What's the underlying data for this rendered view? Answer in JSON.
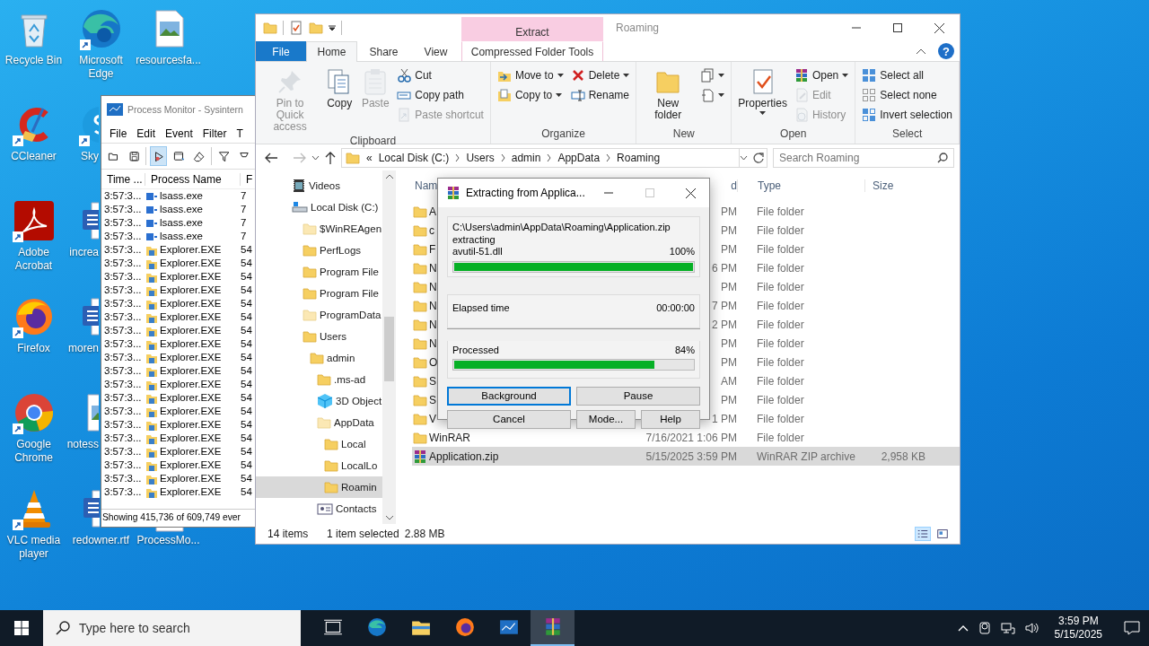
{
  "desktop": {
    "columns": [
      [
        {
          "label": "Recycle Bin",
          "kind": "recycle",
          "shortcut": false
        },
        {
          "label": "CCleaner",
          "kind": "ccleaner",
          "shortcut": true
        },
        {
          "label": "Adobe Acrobat",
          "kind": "acrobat",
          "shortcut": true
        },
        {
          "label": "Firefox",
          "kind": "firefox",
          "shortcut": true
        },
        {
          "label": "Google Chrome",
          "kind": "chrome",
          "shortcut": true
        },
        {
          "label": "VLC media player",
          "kind": "vlc",
          "shortcut": true
        }
      ],
      [
        {
          "label": "Microsoft Edge",
          "kind": "edge",
          "shortcut": true
        },
        {
          "label": "Sky",
          "kind": "skype",
          "shortcut": true
        },
        {
          "label": "increa",
          "kind": "word",
          "shortcut": false
        },
        {
          "label": "moren",
          "kind": "word",
          "shortcut": false
        },
        {
          "label": "notess",
          "kind": "image",
          "shortcut": false
        },
        {
          "label": "redowner.rtf",
          "kind": "word",
          "shortcut": false
        }
      ],
      [
        {
          "label": "resourcesfa...",
          "kind": "image",
          "shortcut": false
        },
        {
          "label": "ProcessMo...",
          "kind": "file",
          "shortcut": false
        }
      ]
    ]
  },
  "process_monitor": {
    "title": "Process Monitor - Sysintern",
    "menu": [
      "File",
      "Edit",
      "Event",
      "Filter",
      "T"
    ],
    "toolbar": [
      {
        "kind": "open",
        "on": false
      },
      {
        "kind": "save",
        "on": false
      },
      {
        "kind": "capture",
        "on": true
      },
      {
        "kind": "autoscroll",
        "on": false
      },
      {
        "kind": "clear",
        "on": false
      },
      {
        "kind": "filter",
        "on": false
      },
      {
        "kind": "highlight",
        "on": false
      }
    ],
    "columns": [
      "Time ...",
      "Process Name",
      "F"
    ],
    "rows": [
      {
        "time": "3:57:3...",
        "process": "lsass.exe",
        "kind": "service",
        "column_3": "7"
      },
      {
        "time": "3:57:3...",
        "process": "lsass.exe",
        "kind": "service",
        "column_3": "7"
      },
      {
        "time": "3:57:3...",
        "process": "lsass.exe",
        "kind": "service",
        "column_3": "7"
      },
      {
        "time": "3:57:3...",
        "process": "lsass.exe",
        "kind": "service",
        "column_3": "7"
      },
      {
        "time": "3:57:3...",
        "process": "Explorer.EXE",
        "kind": "explorer",
        "column_3": "54"
      },
      {
        "time": "3:57:3...",
        "process": "Explorer.EXE",
        "kind": "explorer",
        "column_3": "54"
      },
      {
        "time": "3:57:3...",
        "process": "Explorer.EXE",
        "kind": "explorer",
        "column_3": "54"
      },
      {
        "time": "3:57:3...",
        "process": "Explorer.EXE",
        "kind": "explorer",
        "column_3": "54"
      },
      {
        "time": "3:57:3...",
        "process": "Explorer.EXE",
        "kind": "explorer",
        "column_3": "54"
      },
      {
        "time": "3:57:3...",
        "process": "Explorer.EXE",
        "kind": "explorer",
        "column_3": "54"
      },
      {
        "time": "3:57:3...",
        "process": "Explorer.EXE",
        "kind": "explorer",
        "column_3": "54"
      },
      {
        "time": "3:57:3...",
        "process": "Explorer.EXE",
        "kind": "explorer",
        "column_3": "54"
      },
      {
        "time": "3:57:3...",
        "process": "Explorer.EXE",
        "kind": "explorer",
        "column_3": "54"
      },
      {
        "time": "3:57:3...",
        "process": "Explorer.EXE",
        "kind": "explorer",
        "column_3": "54"
      },
      {
        "time": "3:57:3...",
        "process": "Explorer.EXE",
        "kind": "explorer",
        "column_3": "54"
      },
      {
        "time": "3:57:3...",
        "process": "Explorer.EXE",
        "kind": "explorer",
        "column_3": "54"
      },
      {
        "time": "3:57:3...",
        "process": "Explorer.EXE",
        "kind": "explorer",
        "column_3": "54"
      },
      {
        "time": "3:57:3...",
        "process": "Explorer.EXE",
        "kind": "explorer",
        "column_3": "54"
      },
      {
        "time": "3:57:3...",
        "process": "Explorer.EXE",
        "kind": "explorer",
        "column_3": "54"
      },
      {
        "time": "3:57:3...",
        "process": "Explorer.EXE",
        "kind": "explorer",
        "column_3": "54"
      },
      {
        "time": "3:57:3...",
        "process": "Explorer.EXE",
        "kind": "explorer",
        "column_3": "54"
      },
      {
        "time": "3:57:3...",
        "process": "Explorer.EXE",
        "kind": "explorer",
        "column_3": "54"
      },
      {
        "time": "3:57:3...",
        "process": "Explorer.EXE",
        "kind": "explorer",
        "column_3": "54"
      }
    ],
    "status": "Showing 415,736 of 609,749 ever"
  },
  "explorer": {
    "title": "Roaming",
    "context_group": "Extract",
    "tabs": [
      {
        "label": "File",
        "kind": "file",
        "selected": false
      },
      {
        "label": "Home",
        "kind": "tab",
        "selected": true
      },
      {
        "label": "Share",
        "kind": "tab",
        "selected": false
      },
      {
        "label": "View",
        "kind": "tab",
        "selected": false
      },
      {
        "label": "Compressed Folder Tools",
        "kind": "context",
        "selected": false
      }
    ],
    "help": "?",
    "ribbon": [
      {
        "label": "Clipboard",
        "large": [
          {
            "label": "Pin to Quick access",
            "kind": "pin",
            "disabled": true,
            "dropdown": false
          },
          {
            "label": "Copy",
            "kind": "copy",
            "disabled": false,
            "dropdown": false
          },
          {
            "label": "Paste",
            "kind": "paste",
            "disabled": true,
            "dropdown": false
          }
        ],
        "small": [
          {
            "label": "Cut",
            "kind": "cut",
            "disabled": false,
            "dropdown": false
          },
          {
            "label": "Copy path",
            "kind": "copy-path",
            "disabled": false,
            "dropdown": false
          },
          {
            "label": "Paste shortcut",
            "kind": "paste-shortcut",
            "disabled": true,
            "dropdown": false
          }
        ]
      },
      {
        "label": "Organize",
        "small": [
          {
            "label": "Move to",
            "kind": "move",
            "disabled": false,
            "dropdown": true
          },
          {
            "label": "Copy to",
            "kind": "copy-to",
            "disabled": false,
            "dropdown": true
          },
          {
            "label": "Delete",
            "kind": "delete",
            "disabled": false,
            "dropdown": true
          },
          {
            "label": "Rename",
            "kind": "rename",
            "disabled": false,
            "dropdown": false
          }
        ]
      },
      {
        "label": "New",
        "large": [
          {
            "label": "New folder",
            "kind": "new-folder",
            "disabled": false,
            "dropdown": false
          }
        ],
        "small": [
          {
            "kind": "new-item",
            "disabled": false,
            "dropdown": true
          },
          {
            "kind": "easy-access",
            "disabled": false,
            "dropdown": true
          }
        ]
      },
      {
        "label": "Open",
        "large": [
          {
            "label": "Properties",
            "kind": "properties",
            "disabled": false,
            "dropdown": true
          }
        ],
        "small": [
          {
            "label": "Open",
            "kind": "open",
            "disabled": false,
            "dropdown": true
          },
          {
            "label": "Edit",
            "kind": "edit",
            "disabled": true,
            "dropdown": false
          },
          {
            "label": "History",
            "kind": "history",
            "disabled": true,
            "dropdown": false
          }
        ]
      },
      {
        "label": "Select",
        "small": [
          {
            "label": "Select all",
            "kind": "select-all",
            "disabled": false,
            "dropdown": false
          },
          {
            "label": "Select none",
            "kind": "select-none",
            "disabled": false,
            "dropdown": false
          },
          {
            "label": "Invert selection",
            "kind": "invert",
            "disabled": false,
            "dropdown": false
          }
        ]
      }
    ],
    "address": {
      "overflow": "«",
      "crumbs": [
        "Local Disk (C:)",
        "Users",
        "admin",
        "AppData",
        "Roaming"
      ],
      "search_placeholder": "Search Roaming"
    },
    "navigation": [
      {
        "label": "Videos",
        "kind": "video",
        "selected": false
      },
      {
        "label": "Local Disk (C:)",
        "kind": "drive",
        "selected": false,
        "children": [
          {
            "label": "$WinREAgen",
            "kind": "hidden-folder",
            "selected": false
          },
          {
            "label": "PerfLogs",
            "kind": "folder",
            "selected": false
          },
          {
            "label": "Program File",
            "kind": "folder",
            "selected": false
          },
          {
            "label": "Program File",
            "kind": "folder",
            "selected": false
          },
          {
            "label": "ProgramData",
            "kind": "hidden-folder",
            "selected": false
          },
          {
            "label": "Users",
            "kind": "folder",
            "selected": false,
            "children": [
              {
                "label": "admin",
                "kind": "folder",
                "selected": false,
                "children": [
                  {
                    "label": ".ms-ad",
                    "kind": "folder",
                    "selected": false
                  },
                  {
                    "label": "3D Object",
                    "kind": "cube",
                    "selected": false
                  },
                  {
                    "label": "AppData",
                    "kind": "hidden-folder",
                    "selected": false,
                    "children": [
                      {
                        "label": "Local",
                        "kind": "folder",
                        "selected": false
                      },
                      {
                        "label": "LocalLo",
                        "kind": "folder",
                        "selected": false
                      },
                      {
                        "label": "Roamin",
                        "kind": "folder",
                        "selected": true
                      }
                    ]
                  },
                  {
                    "label": "Contacts",
                    "kind": "contacts",
                    "selected": false
                  }
                ]
              }
            ]
          }
        ]
      }
    ],
    "columns": [
      "Nam",
      "d",
      "Type",
      "Size"
    ],
    "files": [
      {
        "name": "A",
        "date": "PM",
        "type": "File folder",
        "kind": "folder",
        "selected": false
      },
      {
        "name": "c",
        "date": "PM",
        "type": "File folder",
        "kind": "folder",
        "selected": false
      },
      {
        "name": "F",
        "date": "PM",
        "type": "File folder",
        "kind": "folder",
        "selected": false
      },
      {
        "name": "N",
        "date": "6 PM",
        "type": "File folder",
        "kind": "folder",
        "selected": false
      },
      {
        "name": "N",
        "date": "PM",
        "type": "File folder",
        "kind": "folder",
        "selected": false
      },
      {
        "name": "N",
        "date": "7 PM",
        "type": "File folder",
        "kind": "folder",
        "selected": false
      },
      {
        "name": "N",
        "date": "2 PM",
        "type": "File folder",
        "kind": "folder",
        "selected": false
      },
      {
        "name": "N",
        "date": "PM",
        "type": "File folder",
        "kind": "folder",
        "selected": false
      },
      {
        "name": "O",
        "date": "PM",
        "type": "File folder",
        "kind": "folder",
        "selected": false
      },
      {
        "name": "S",
        "date": "AM",
        "type": "File folder",
        "kind": "folder",
        "selected": false
      },
      {
        "name": "S",
        "date": "PM",
        "type": "File folder",
        "kind": "folder",
        "selected": false
      },
      {
        "name": "V",
        "date": "1 PM",
        "type": "File folder",
        "kind": "folder",
        "selected": false
      },
      {
        "name": "WinRAR",
        "date": "7/16/2021 1:06 PM",
        "type": "File folder",
        "kind": "folder",
        "selected": false
      },
      {
        "name": "Application.zip",
        "date": "5/15/2025 3:59 PM",
        "type": "WinRAR ZIP archive",
        "size": "2,958 KB",
        "kind": "archive",
        "selected": true
      }
    ],
    "status": {
      "count": "14 items",
      "selection": "1 item selected",
      "size": "2.88 MB"
    },
    "views": [
      {
        "kind": "details",
        "selected": true
      },
      {
        "kind": "tiles",
        "selected": false
      }
    ]
  },
  "dialog": {
    "title": "Extracting from Applica...",
    "archive": "C:\\Users\\admin\\AppData\\Roaming\\Application.zip",
    "action": "extracting",
    "file": "avutil-51.dll",
    "file_percent": "100%",
    "file_progress": {
      "level": 1.0
    },
    "elapsed_label": "Elapsed time",
    "elapsed": "00:00:00",
    "processed_label": "Processed",
    "processed_percent": "84%",
    "processed_progress": {
      "level": 0.84
    },
    "buttons": [
      {
        "label": "Background",
        "focused": true
      },
      {
        "label": "Pause",
        "focused": false
      },
      {
        "label": "Cancel",
        "focused": false
      },
      {
        "label": "Mode...",
        "focused": false
      },
      {
        "label": "Help",
        "focused": false
      }
    ]
  },
  "taskbar": {
    "search_placeholder": "Type here to search",
    "apps": [
      {
        "kind": "task-view",
        "active": false
      },
      {
        "kind": "edge",
        "active": false
      },
      {
        "kind": "explorer",
        "active": false
      },
      {
        "kind": "firefox",
        "active": false
      },
      {
        "kind": "procmon",
        "active": false
      },
      {
        "kind": "winrar",
        "active": true
      }
    ],
    "time": "3:59 PM",
    "date": "5/15/2025"
  }
}
